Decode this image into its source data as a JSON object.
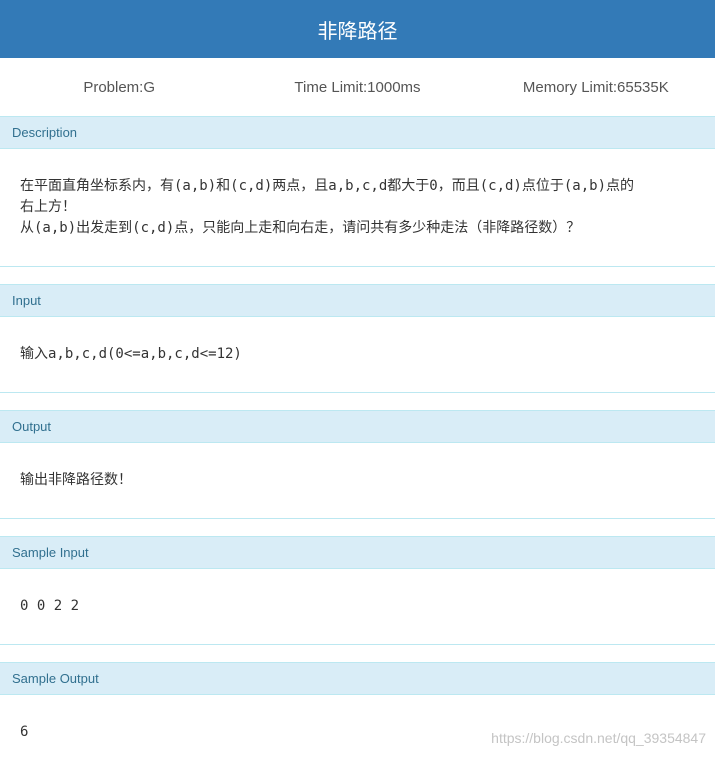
{
  "header": {
    "title": "非降路径"
  },
  "meta": {
    "problem": "Problem:G",
    "time_limit": "Time Limit:1000ms",
    "memory_limit": "Memory Limit:65535K"
  },
  "sections": {
    "description": {
      "heading": "Description",
      "line1": "在平面直角坐标系内，有(a,b)和(c,d)两点，且a,b,c,d都大于0，而且(c,d)点位于(a,b)点的",
      "line2": "右上方！",
      "line3": "从(a,b)出发走到(c,d)点，只能向上走和向右走，请问共有多少种走法（非降路径数）？"
    },
    "input": {
      "heading": "Input",
      "text": "输入a,b,c,d(0<=a,b,c,d<=12)"
    },
    "output": {
      "heading": "Output",
      "text": "输出非降路径数！"
    },
    "sample_input": {
      "heading": "Sample Input",
      "text": "0 0 2 2"
    },
    "sample_output": {
      "heading": "Sample Output",
      "text": "6"
    }
  },
  "watermark": "https://blog.csdn.net/qq_39354847",
  "colors": {
    "header_bg": "#337ab7",
    "panel_heading_bg": "#d9edf7",
    "panel_heading_text": "#31708f"
  }
}
